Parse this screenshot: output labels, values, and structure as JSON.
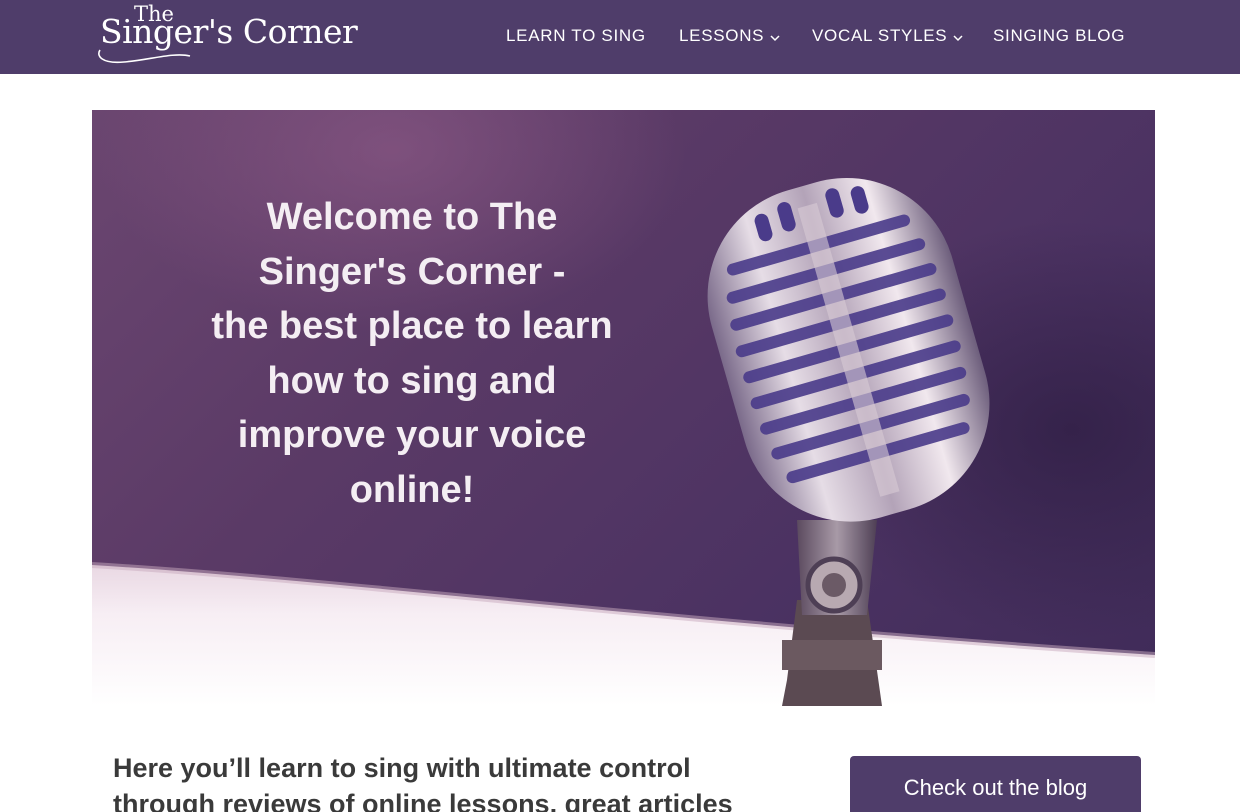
{
  "site": {
    "logo_top": "The",
    "logo_main": "Singer's Corner"
  },
  "nav": {
    "items": [
      {
        "label": "LEARN TO SING",
        "has_dropdown": false
      },
      {
        "label": "LESSONS",
        "has_dropdown": true
      },
      {
        "label": "VOCAL STYLES",
        "has_dropdown": true
      },
      {
        "label": "SINGING BLOG",
        "has_dropdown": false
      }
    ]
  },
  "hero": {
    "heading_lines": [
      "Welcome to The",
      "Singer's Corner -",
      "the best place to learn",
      "how to sing and",
      "improve your voice",
      "online!"
    ]
  },
  "intro": {
    "text": "Here you’ll learn to sing with ultimate control through reviews of online lessons, great articles"
  },
  "cta": {
    "label": "Check out the blog"
  },
  "colors": {
    "brand": "#4f3d6a",
    "hero_text": "#f4eef3",
    "body_text": "#3a3a3a"
  },
  "icons": {
    "dropdown": "chevron-down-icon",
    "hero_image": "microphone-icon"
  }
}
